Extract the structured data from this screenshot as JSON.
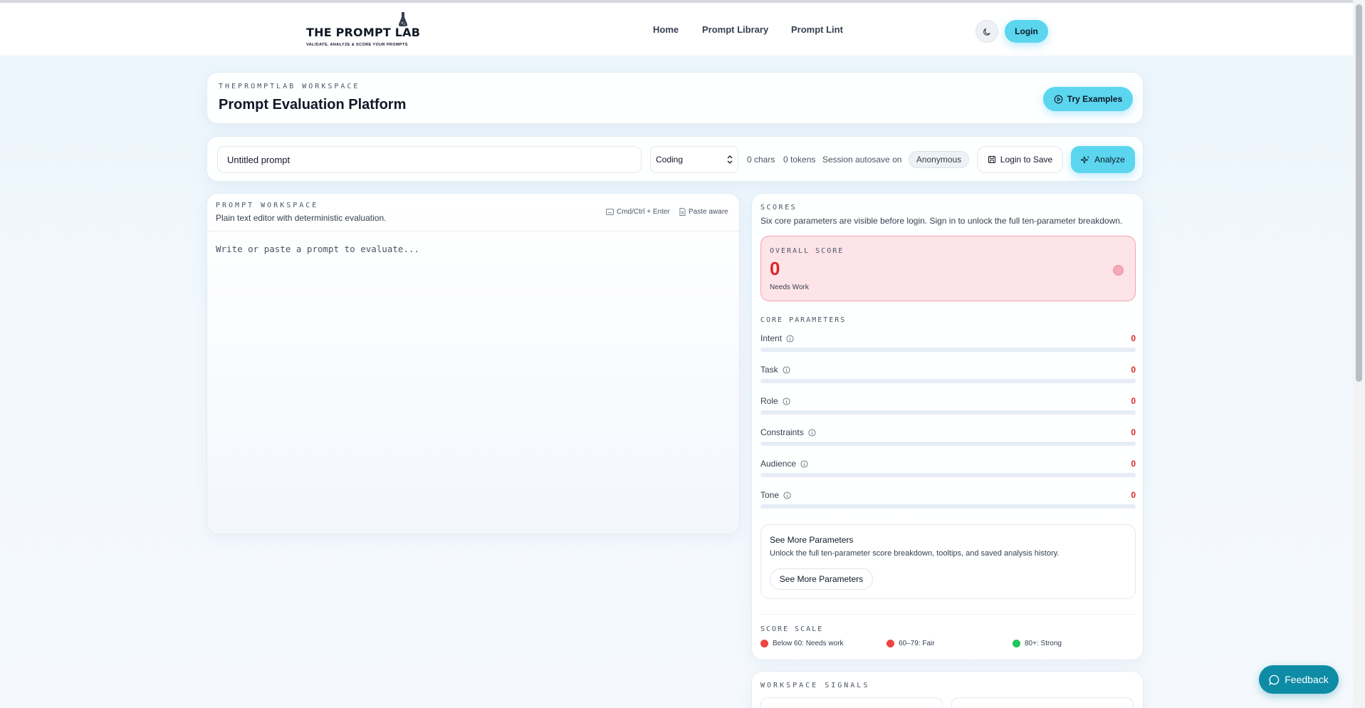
{
  "header": {
    "logo_title": "THE PROMPT LAB",
    "logo_tagline": "VALIDATE, ANALYZE & SCORE YOUR PROMPTS",
    "nav": [
      "Home",
      "Prompt Library",
      "Prompt Lint"
    ],
    "login_label": "Login",
    "theme_icon": "moon-icon"
  },
  "title_card": {
    "eyebrow": "THEPROMPTLAB WORKSPACE",
    "title": "Prompt Evaluation Platform",
    "try_label": "Try Examples"
  },
  "toolbar": {
    "title_value": "Untitled prompt",
    "category": "Coding",
    "chars": "0 chars",
    "tokens": "0 tokens",
    "autosave": "Session autosave on",
    "user_chip": "Anonymous",
    "save_label": "Login to Save",
    "analyze_label": "Analyze"
  },
  "workspace": {
    "eyebrow": "PROMPT WORKSPACE",
    "subtitle": "Plain text editor with deterministic evaluation.",
    "hint_shortcut": "Cmd/Ctrl + Enter",
    "hint_paste": "Paste aware",
    "placeholder": "Write or paste a prompt to evaluate..."
  },
  "scores": {
    "eyebrow": "SCORES",
    "subtitle": "Six core parameters are visible before login. Sign in to unlock the full ten-parameter breakdown.",
    "overall": {
      "eyebrow": "OVERALL SCORE",
      "value": "0",
      "label": "Needs Work"
    },
    "core_eyebrow": "CORE PARAMETERS",
    "params": [
      {
        "label": "Intent",
        "value": "0"
      },
      {
        "label": "Task",
        "value": "0"
      },
      {
        "label": "Role",
        "value": "0"
      },
      {
        "label": "Constraints",
        "value": "0"
      },
      {
        "label": "Audience",
        "value": "0"
      },
      {
        "label": "Tone",
        "value": "0"
      }
    ],
    "more": {
      "title": "See More Parameters",
      "subtitle": "Unlock the full ten-parameter score breakdown, tooltips, and saved analysis history.",
      "button": "See More Parameters"
    },
    "scale_eyebrow": "SCORE SCALE",
    "scale": [
      {
        "label": "Below 60: Needs work",
        "color": "#ef4444"
      },
      {
        "label": "60–79: Fair",
        "color": "#ef4444"
      },
      {
        "label": "80+: Strong",
        "color": "#22c55e"
      }
    ]
  },
  "signals": {
    "eyebrow": "WORKSPACE SIGNALS"
  },
  "feedback_label": "Feedback",
  "colors": {
    "accent": "#5bd6ee",
    "danger": "#dc2626",
    "feedback": "#0e8ca6"
  }
}
